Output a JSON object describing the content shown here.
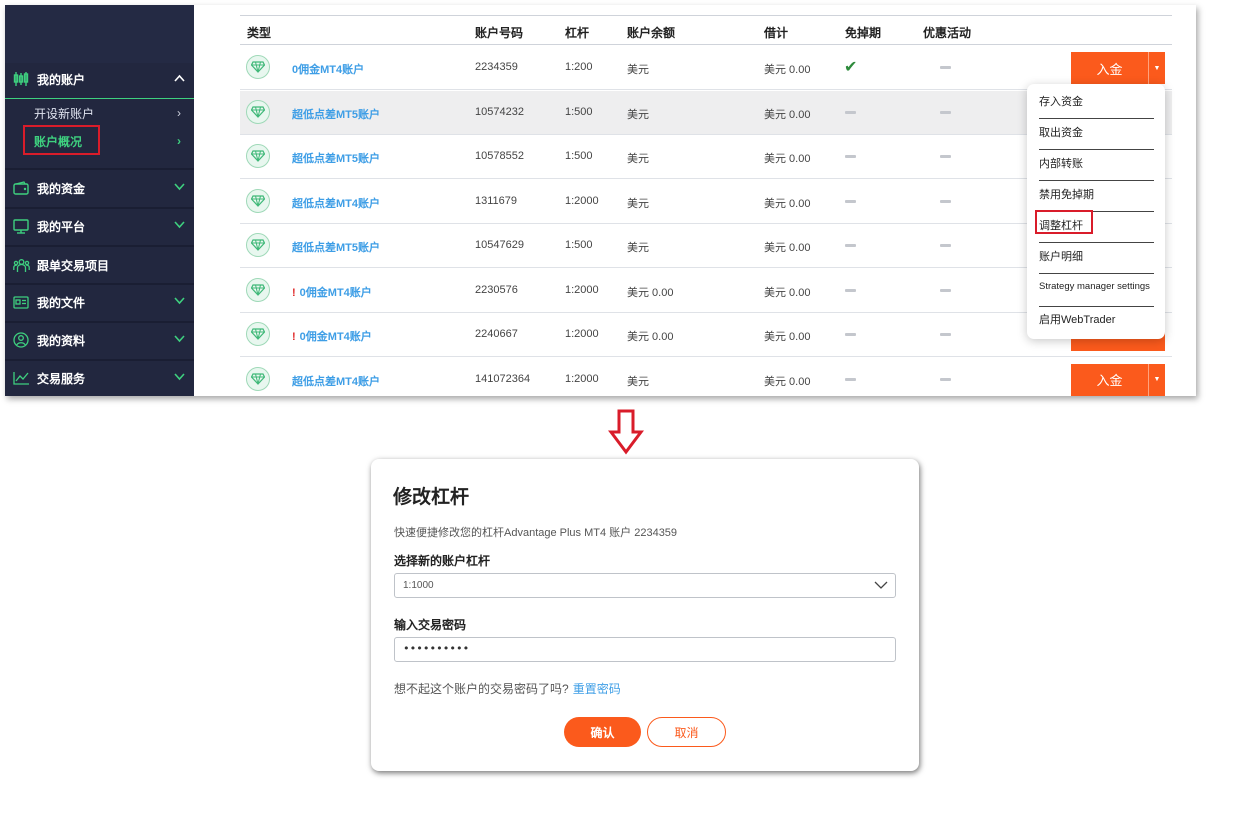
{
  "sidebar": {
    "my_account": "我的账户",
    "open_account": "开设新账户",
    "account_overview": "账户概况",
    "my_funds": "我的资金",
    "my_platform": "我的平台",
    "copy_trading": "跟单交易项目",
    "my_documents": "我的文件",
    "my_profile": "我的资料",
    "trading_services": "交易服务"
  },
  "table": {
    "headers": {
      "type": "类型",
      "account_no": "账户号码",
      "leverage": "杠杆",
      "balance": "账户余额",
      "credit": "借计",
      "swap_free": "免掉期",
      "promo": "优惠活动"
    },
    "deposit_label": "入金",
    "rows": [
      {
        "name": "0佣金MT4账户",
        "number": "2234359",
        "leverage": "1:200",
        "balance": "美元",
        "credit": "美元 0.00",
        "warning": ""
      },
      {
        "name": "超低点差MT5账户",
        "number": "10574232",
        "leverage": "1:500",
        "balance": "美元",
        "credit": "美元 0.00",
        "warning": ""
      },
      {
        "name": "超低点差MT5账户",
        "number": "10578552",
        "leverage": "1:500",
        "balance": "美元",
        "credit": "美元 0.00",
        "warning": ""
      },
      {
        "name": "超低点差MT4账户",
        "number": "1311679",
        "leverage": "1:2000",
        "balance": "美元",
        "credit": "美元 0.00",
        "warning": ""
      },
      {
        "name": "超低点差MT5账户",
        "number": "10547629",
        "leverage": "1:500",
        "balance": "美元",
        "credit": "美元 0.00",
        "warning": ""
      },
      {
        "name": "0佣金MT4账户",
        "number": "2230576",
        "leverage": "1:2000",
        "balance": "美元 0.00",
        "credit": "美元 0.00",
        "warning": "!"
      },
      {
        "name": "0佣金MT4账户",
        "number": "2240667",
        "leverage": "1:2000",
        "balance": "美元 0.00",
        "credit": "美元 0.00",
        "warning": "!"
      },
      {
        "name": "超低点差MT4账户",
        "number": "141072364",
        "leverage": "1:2000",
        "balance": "美元",
        "credit": "美元 0.00",
        "warning": ""
      }
    ]
  },
  "dropdown": {
    "items": [
      "存入资金",
      "取出资金",
      "内部转账",
      "禁用免掉期",
      "调整杠杆",
      "账户明细",
      "Strategy manager settings",
      "启用WebTrader"
    ]
  },
  "modal": {
    "title": "修改杠杆",
    "description": "快速便捷修改您的杠杆Advantage Plus MT4 账户 2234359",
    "select_label": "选择新的账户杠杆",
    "select_value": "1:1000",
    "password_label": "输入交易密码",
    "password_value": "••••••••••",
    "forgot_text": "想不起这个账户的交易密码了吗?",
    "reset_link": "重置密码",
    "confirm": "确认",
    "cancel": "取消"
  },
  "colors": {
    "sidebar_bg": "#22273f",
    "accent_green": "#3ed07f",
    "deposit_orange": "#fb5a1c",
    "link_blue": "#3e9ee6",
    "highlight_red": "#d91c2a"
  }
}
